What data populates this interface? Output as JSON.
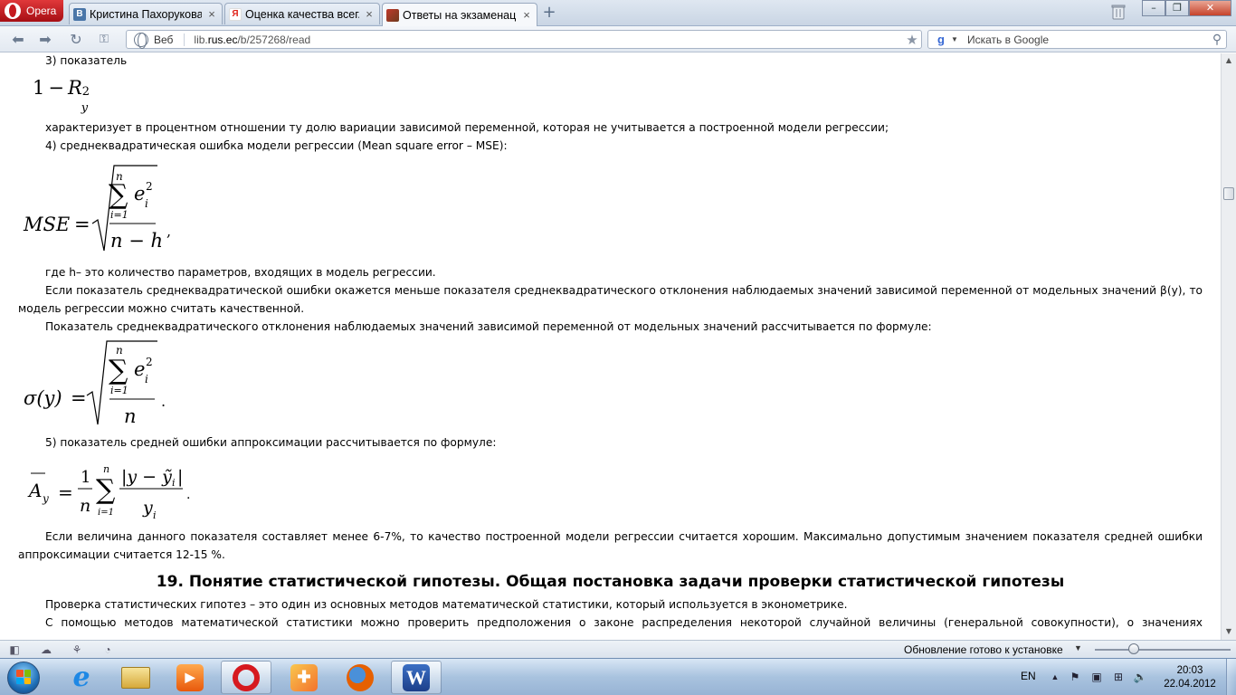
{
  "browser": {
    "menu_label": "Opera",
    "tabs": [
      {
        "title": "Кристина Пахорукова",
        "favicon": "vk-icon",
        "color": "#4a76a8",
        "glyph": "В"
      },
      {
        "title": "Оценка качества всег...",
        "favicon": "yandex-icon",
        "color": "#ffffff",
        "glyph": "Я"
      },
      {
        "title": "Ответы на экзаменац...",
        "favicon": "book-icon",
        "color": "#8b5a2b",
        "glyph": ""
      }
    ],
    "address": {
      "web_label": "Веб",
      "url_prefix": "lib.",
      "url_domain": "rus.ec",
      "url_path": "/b/257268/read"
    },
    "search_placeholder": "Искать в Google"
  },
  "doc": {
    "item3_label": "3) показатель",
    "item3_text": "характеризует в процентном отношении ту долю вариации зависимой переменной, которая не учитывается а построенной модели регрессии;",
    "item4_label": "4) среднеквадратическая ошибка модели регрессии (Mean square error – MSE):",
    "h_text": "где h– это количество параметров, входящих в модель регрессии.",
    "p_mse": "Если показатель среднеквадратической ошибки окажется меньше показателя среднеквадратического отклонения наблюдаемых значений зависимой переменной от модельных значений β(y), то модель регрессии можно считать качественной.",
    "p_sigma": "Показатель среднеквадратического отклонения наблюдаемых значений зависимой переменной от модельных значений рассчитывается по формуле:",
    "item5_label": "5) показатель средней ошибки аппроксимации рассчитывается по формуле:",
    "p_approx": "Если величина данного показателя составляет менее 6-7%, то качество построенной модели регрессии считается хорошим. Максимально допустимым значением показателя средней ошибки аппроксимации считается 12-15 %.",
    "section_title": "19. Понятие статистической гипотезы. Общая постановка задачи проверки статистической гипотезы",
    "p_hyp1": "Проверка статистических гипотез – это один из основных методов математической статистики, который используется в эконометрике.",
    "p_hyp2": "С помощью методов математической статистики можно проверить предположения о законе распределения некоторой случайной величины (генеральной совокупности), о значениях"
  },
  "formulas": {
    "f1": {
      "one": "1",
      "minus": "−",
      "R": "R",
      "sub": "y",
      "sup": "2"
    },
    "mse": {
      "lhs": "MSE",
      "eq": "=",
      "sum_top": "n",
      "sum_bot": "i=1",
      "e": "e",
      "e_sub": "i",
      "e_sup": "2",
      "den": "n − h",
      "tail": ","
    },
    "sigma": {
      "lhs": "σ(y)",
      "eq": "=",
      "sum_top": "n",
      "sum_bot": "i=1",
      "e": "e",
      "e_sub": "i",
      "e_sup": "2",
      "den": "n",
      "tail": "."
    },
    "approx": {
      "A": "A",
      "A_sub": "y",
      "eq": "=",
      "frac_num": "1",
      "frac_den": "n",
      "sum_top": "n",
      "sum_bot": "i=1",
      "num": "|y − ỹ",
      "num_sub": "i",
      "num_close": "|",
      "den": "y",
      "den_sub": "i",
      "tail": "."
    }
  },
  "status": {
    "update_text": "Обновление готово к установке"
  },
  "taskbar": {
    "lang": "EN",
    "time": "20:03",
    "date": "22.04.2012"
  }
}
